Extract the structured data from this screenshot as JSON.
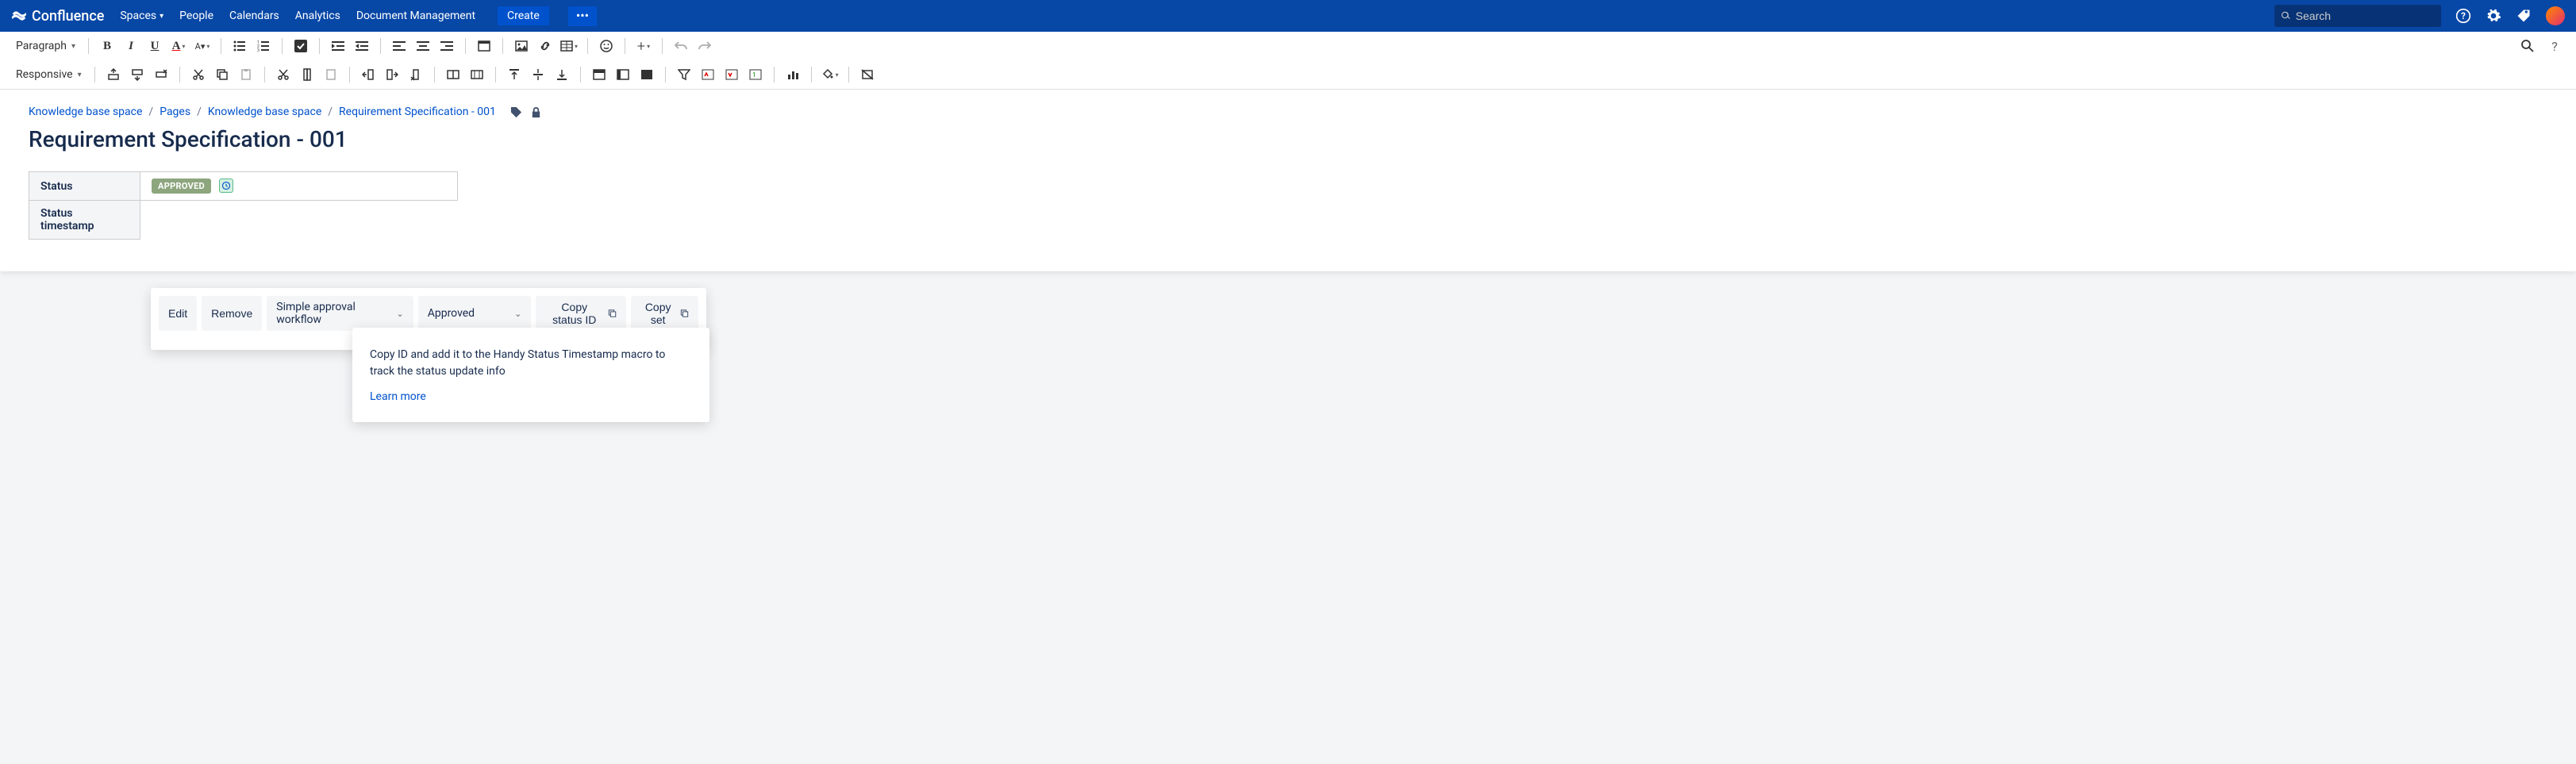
{
  "brand": "Confluence",
  "nav": {
    "spaces": "Spaces",
    "people": "People",
    "calendars": "Calendars",
    "analytics": "Analytics",
    "docmgmt": "Document Management",
    "create": "Create"
  },
  "search": {
    "placeholder": "Search"
  },
  "toolbar": {
    "para": "Paragraph",
    "responsive": "Responsive"
  },
  "breadcrumbs": {
    "b1": "Knowledge base space",
    "b2": "Pages",
    "b3": "Knowledge base space",
    "b4": "Requirement Specification - 001"
  },
  "page": {
    "title": "Requirement Specification - 001"
  },
  "table": {
    "row1_h": "Status",
    "row1_v": "APPROVED",
    "row2_h": "Status timestamp"
  },
  "popup": {
    "edit": "Edit",
    "remove": "Remove",
    "workflow": "Simple approval workflow",
    "approved": "Approved",
    "copyid": "Copy status ID",
    "copyset": "Copy set",
    "tip": "Copy ID and add it to the Handy Status Timestamp macro to track the status update info",
    "learn": "Learn more"
  }
}
